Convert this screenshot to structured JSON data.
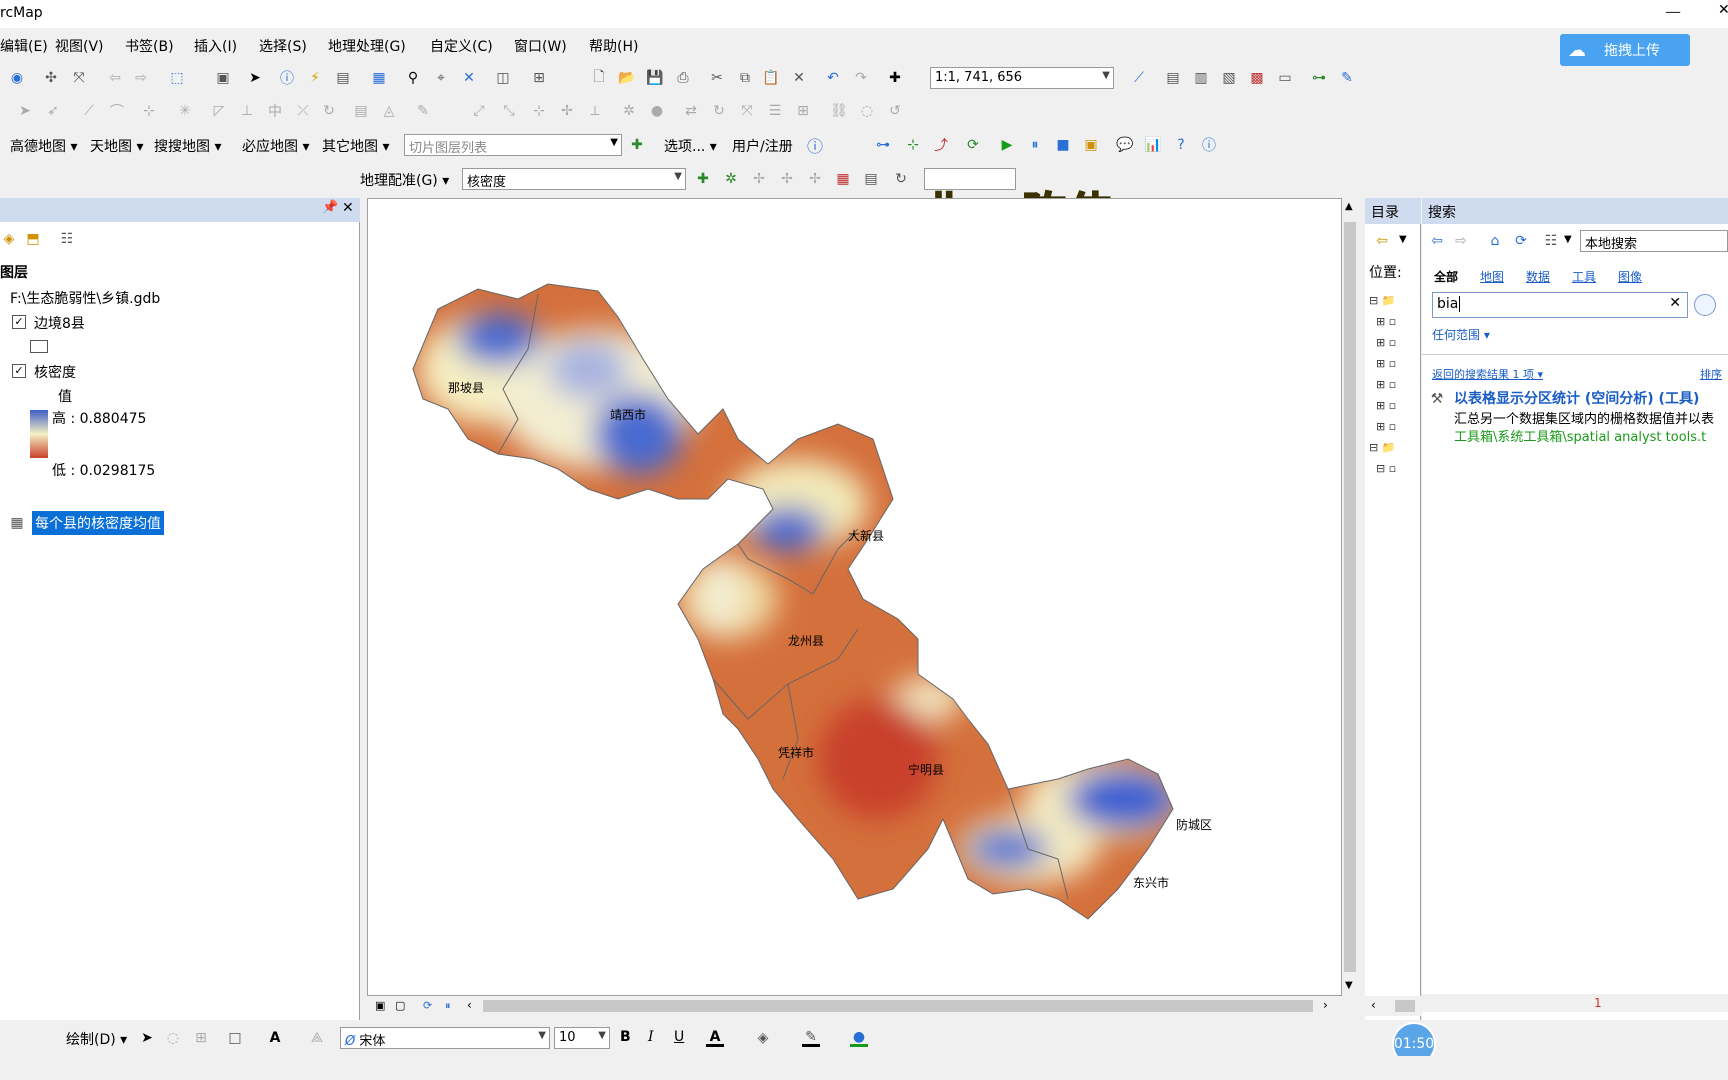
{
  "window": {
    "title": "rcMap"
  },
  "menu": [
    "编辑(E)",
    "视图(V)",
    "书签(B)",
    "插入(I)",
    "选择(S)",
    "地理处理(G)",
    "自定义(C)",
    "窗口(W)",
    "帮助(H)"
  ],
  "upload_button": "拖拽上传",
  "scale": "1:1, 741, 656",
  "overlay_text": "曲 : 陈伟",
  "basemap_toolbar": {
    "items": [
      "高德地图",
      "天地图",
      "搜搜地图",
      "必应地图",
      "其它地图"
    ],
    "tile_list_placeholder": "切片图层列表",
    "options": "选项...",
    "user_register": "用户/注册"
  },
  "georef_toolbar": {
    "label": "地理配准(G)",
    "layer": "核密度"
  },
  "toc": {
    "heading": "图层",
    "gdb": "F:\\生态脆弱性\\乡镇.gdb",
    "layer1": "边境8县",
    "layer2": "核密度",
    "value_label": "值",
    "high": "高 : 0.880475",
    "low": "低 : 0.0298175",
    "table": "每个县的核密度均值",
    "colors": {
      "high": "#3f5fc9",
      "mid": "#f6f0c4",
      "low": "#c9412a",
      "selected": "#0a6fd6"
    }
  },
  "map_labels": [
    "那坡县",
    "靖西市",
    "大新县",
    "龙州县",
    "凭祥市",
    "宁明县",
    "防城区",
    "东兴市"
  ],
  "catalog": {
    "title": "目录",
    "location": "位置:"
  },
  "search": {
    "title": "搜索",
    "scope": "本地搜索",
    "tabs": [
      "全部",
      "地图",
      "数据",
      "工具",
      "图像"
    ],
    "query": "bia",
    "range": "任何范围",
    "results_count": "返回的搜索结果 1 项",
    "sort": "排序",
    "result": {
      "title": "以表格显示分区统计 (空间分析) (工具)",
      "desc": "汇总另一个数据集区域内的栅格数据值并以表",
      "path": "工具箱\\系统工具箱\\spatial analyst tools.t"
    },
    "page": "1"
  },
  "draw_toolbar": {
    "label": "绘制(D)",
    "font": "宋体",
    "size": "10"
  },
  "timer": "01:50"
}
